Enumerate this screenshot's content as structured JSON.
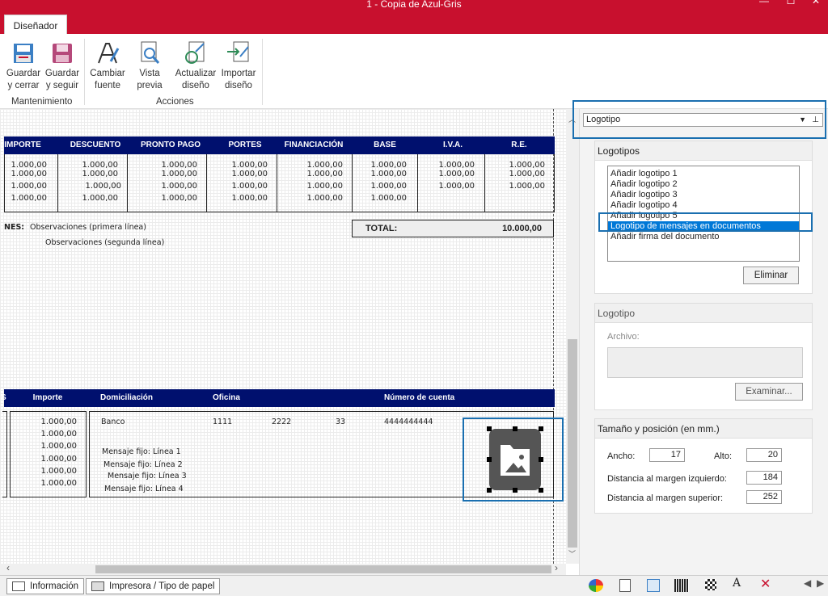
{
  "window": {
    "title": "1 - Copia de Azul-Gris",
    "minimize_glyph": "—",
    "maximize_glyph": "☐",
    "close_glyph": "✕"
  },
  "ribbon": {
    "tab": "Diseñador",
    "buttons": [
      {
        "line1": "Guardar",
        "line2": "y cerrar",
        "icon": "save-close-icon"
      },
      {
        "line1": "Guardar",
        "line2": "y seguir",
        "icon": "save-continue-icon"
      },
      {
        "line1": "Cambiar",
        "line2": "fuente",
        "icon": "font-icon"
      },
      {
        "line1": "Vista",
        "line2": "previa",
        "icon": "preview-icon"
      },
      {
        "line1": "Actualizar",
        "line2": "diseño",
        "icon": "refresh-design-icon"
      },
      {
        "line1": "Importar",
        "line2": "diseño",
        "icon": "import-design-icon"
      }
    ],
    "groups": {
      "mantenimiento": "Mantenimiento",
      "acciones": "Acciones"
    }
  },
  "canvas": {
    "totals_header": [
      "IMPORTE",
      "DESCUENTO",
      "PRONTO PAGO",
      "PORTES",
      "FINANCIACIÓN",
      "BASE",
      "I.V.A.",
      "R.E."
    ],
    "sample_value": "1.000,00",
    "obs_label": "NES:",
    "obs_line1": "Observaciones (primera línea)",
    "obs_line2": "Observaciones (segunda línea)",
    "total_label": "TOTAL:",
    "total_value": "10.000,00",
    "payment_header": {
      "c0": "S",
      "importe": "Importe",
      "domiciliacion": "Domiciliación",
      "oficina": "Oficina",
      "cuenta": "Número de cuenta"
    },
    "payment": {
      "banco": "Banco",
      "oficina": "1111",
      "c2": "2222",
      "c3": "33",
      "cuenta": "4444444444"
    },
    "mensajes": [
      "Mensaje fijo: Línea 1",
      "Mensaje fijo: Línea 2",
      "Mensaje fijo: Línea 3",
      "Mensaje fijo: Línea 4"
    ]
  },
  "bottom_tabs": {
    "info": "Información",
    "printer": "Impresora / Tipo de papel"
  },
  "panel": {
    "combo_value": "Logotipo",
    "logotipos_title": "Logotipos",
    "logotipos": [
      "Añadir logotipo 1",
      "Añadir logotipo 2",
      "Añadir logotipo 3",
      "Añadir logotipo 4",
      "Añadir logotipo 5",
      "Logotipo de mensajes en documentos",
      "Añadir firma del documento"
    ],
    "selected_index": 5,
    "eliminar": "Eliminar",
    "logotipo_title": "Logotipo",
    "archivo_label": "Archivo:",
    "examinar": "Examinar...",
    "size_title": "Tamaño y posición (en mm.)",
    "ancho_label": "Ancho:",
    "ancho": "17",
    "alto_label": "Alto:",
    "alto": "20",
    "izq_label": "Distancia al margen izquierdo:",
    "izq": "184",
    "sup_label": "Distancia al margen superior:",
    "sup": "252"
  },
  "colors": {
    "title_bar": "#c8102e",
    "table_header": "#00106e",
    "selection": "#0078d7",
    "highlight_border": "#1a6fb0"
  }
}
